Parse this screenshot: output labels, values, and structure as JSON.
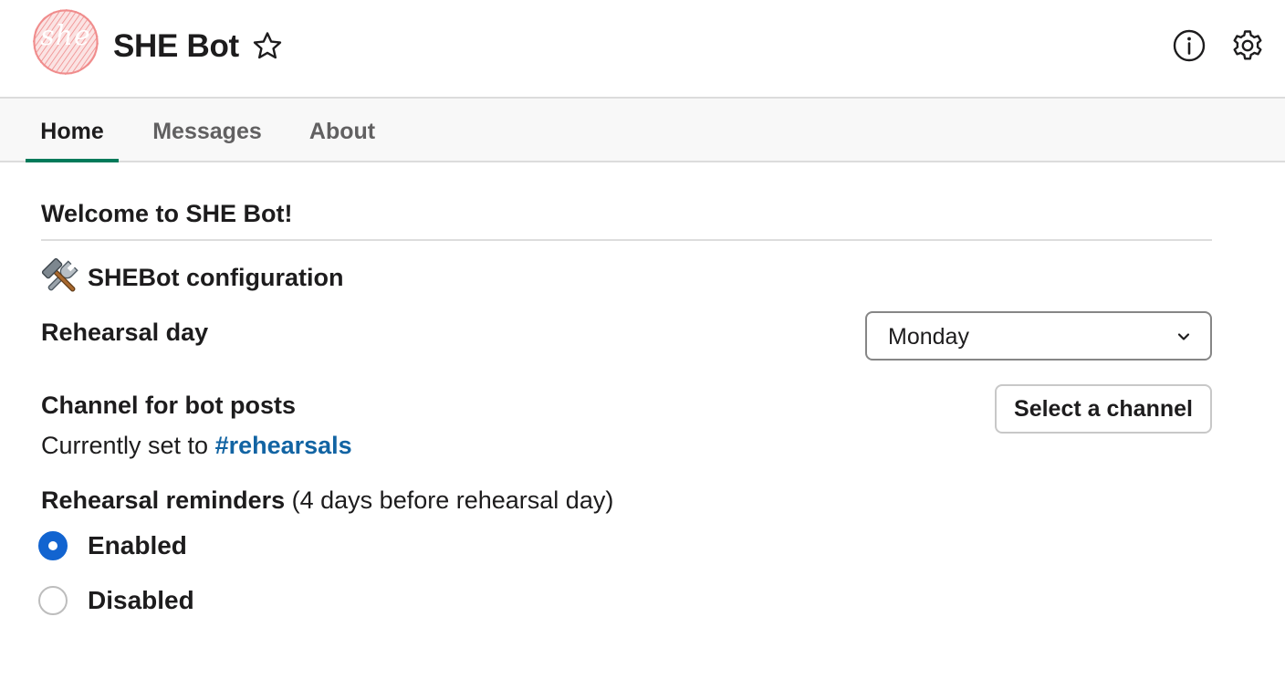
{
  "header": {
    "title": "SHE Bot",
    "logo_text": "she",
    "icons": {
      "favorite": "star-icon",
      "info": "info-icon",
      "settings": "gear-icon"
    }
  },
  "tabs": [
    {
      "label": "Home",
      "active": true
    },
    {
      "label": "Messages",
      "active": false
    },
    {
      "label": "About",
      "active": false
    }
  ],
  "home": {
    "welcome": "Welcome to SHE Bot!",
    "config_title": "SHEBot configuration",
    "config_icon": "hammer-and-wrench-icon",
    "rehearsal_day": {
      "label": "Rehearsal day",
      "selected": "Monday"
    },
    "channel": {
      "label": "Channel for bot posts",
      "current_prefix": "Currently set to ",
      "current_channel": "#rehearsals",
      "button_label": "Select a channel"
    },
    "reminders": {
      "label": "Rehearsal reminders",
      "note": " (4 days before rehearsal day)",
      "options": [
        {
          "label": "Enabled",
          "selected": true
        },
        {
          "label": "Disabled",
          "selected": false
        }
      ]
    }
  },
  "colors": {
    "accent_tab": "#007a5a",
    "link": "#1264a3",
    "radio_selected": "#1264d0",
    "logo": "#f28b8b"
  }
}
